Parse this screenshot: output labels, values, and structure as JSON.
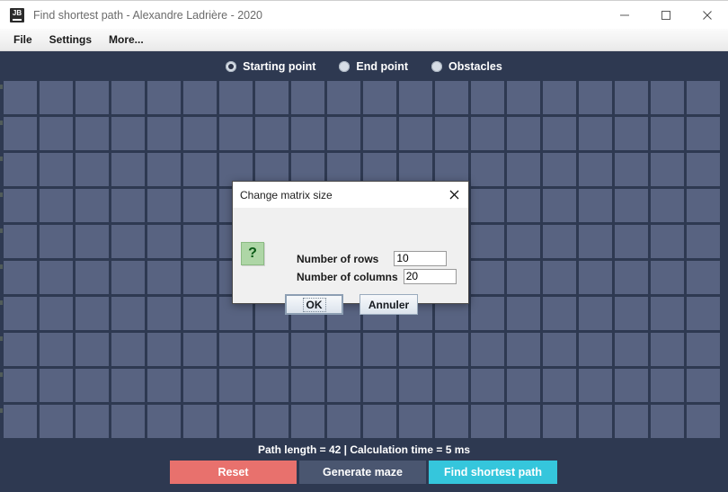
{
  "window": {
    "title": "Find shortest path - Alexandre Ladrière - 2020",
    "icon": "jb-app-icon",
    "controls": {
      "minimize": "minimize-icon",
      "maximize": "maximize-icon",
      "close": "close-icon"
    }
  },
  "menubar": {
    "items": [
      {
        "label": "File"
      },
      {
        "label": "Settings"
      },
      {
        "label": "More..."
      }
    ]
  },
  "mode_toolbar": {
    "options": [
      {
        "label": "Starting point",
        "selected": true
      },
      {
        "label": "End point",
        "selected": false
      },
      {
        "label": "Obstacles",
        "selected": false
      }
    ]
  },
  "grid": {
    "rows": 10,
    "columns": 20,
    "cell_color": "#586381",
    "background_color": "#2e3951"
  },
  "status": {
    "text": "Path length = 42   |   Calculation time = 5 ms",
    "path_length": 42,
    "calculation_time": "5 ms"
  },
  "actions": {
    "reset_label": "Reset",
    "reset_color": "#e8716d",
    "generate_label": "Generate maze",
    "generate_color": "#4a5670",
    "find_label": "Find shortest path",
    "find_color": "#35c6dc"
  },
  "dialog": {
    "title": "Change matrix size",
    "close_icon": "close-icon",
    "help_icon": "question-mark-icon",
    "fields": [
      {
        "label": "Number of rows",
        "value": "10"
      },
      {
        "label": "Number of columns",
        "value": "20"
      }
    ],
    "buttons": {
      "ok_label": "OK",
      "cancel_label": "Annuler"
    }
  }
}
